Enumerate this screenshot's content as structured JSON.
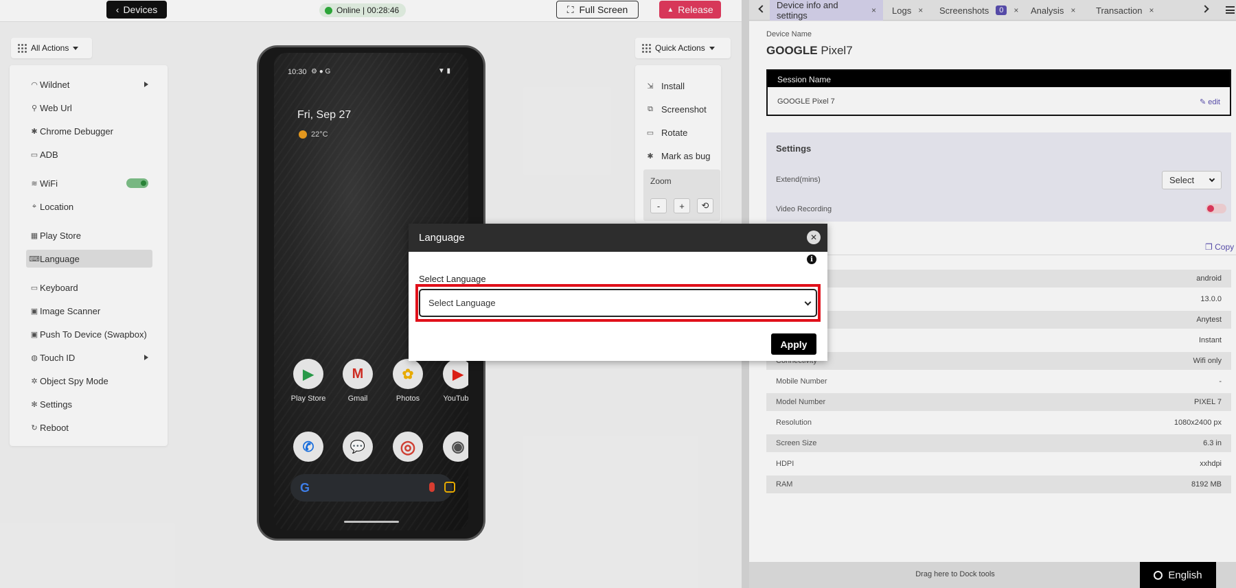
{
  "topbar": {
    "devices_label": "Devices",
    "status_text": "Online | 00:28:46",
    "fullscreen_label": "Full Screen",
    "release_label": "Release"
  },
  "all_actions": {
    "button_label": "All Actions",
    "items": [
      {
        "label": "Wildnet",
        "icon": "wildnet-icon"
      },
      {
        "label": "Web Url",
        "icon": "link-icon"
      },
      {
        "label": "Chrome Debugger",
        "icon": "bug-icon"
      },
      {
        "label": "ADB",
        "icon": "terminal-icon"
      },
      {
        "label": "WiFi",
        "icon": "wifi-icon"
      },
      {
        "label": "Location",
        "icon": "location-pin-icon"
      },
      {
        "label": "Play Store",
        "icon": "apps-icon"
      },
      {
        "label": "Language",
        "icon": "language-icon"
      },
      {
        "label": "Keyboard",
        "icon": "keyboard-icon"
      },
      {
        "label": "Image Scanner",
        "icon": "scanner-icon"
      },
      {
        "label": "Push To Device (Swapbox)",
        "icon": "push-icon"
      },
      {
        "label": "Touch ID",
        "icon": "fingerprint-icon"
      },
      {
        "label": "Object Spy Mode",
        "icon": "spy-icon"
      },
      {
        "label": "Settings",
        "icon": "gear-icon"
      },
      {
        "label": "Reboot",
        "icon": "reboot-icon"
      }
    ]
  },
  "quick_actions": {
    "button_label": "Quick Actions",
    "items": [
      "Install",
      "Screenshot",
      "Rotate",
      "Mark as bug"
    ],
    "zoom_label": "Zoom",
    "zoom_minus": "-",
    "zoom_plus": "+"
  },
  "phone": {
    "time": "10:30",
    "status_glyphs": "⚙ ● G",
    "right_glyphs": "▼ ▮",
    "date": "Fri, Sep 27",
    "temperature": "22°C",
    "apps_row1": [
      "Play Store",
      "Gmail",
      "Photos",
      "YouTube"
    ],
    "apps_row1_glyphs": [
      "▶",
      "M",
      "✿",
      "▶"
    ],
    "apps_row2_icons": [
      "phone-icon",
      "messages-icon",
      "chrome-icon",
      "camera-icon"
    ],
    "apps_row2_glyphs": [
      "✆",
      "💬",
      "◎",
      "◉"
    ],
    "search_logo": "G"
  },
  "modal": {
    "title": "Language",
    "close_glyph": "✕",
    "info_glyph": "i",
    "select_label": "Select Language",
    "select_value": "Select Language",
    "apply_label": "Apply"
  },
  "right_panel": {
    "tabs": [
      {
        "label": "Device info and settings"
      },
      {
        "label": "Logs"
      },
      {
        "label": "Screenshots",
        "badge": "0"
      },
      {
        "label": "Analysis"
      },
      {
        "label": "Transaction"
      }
    ],
    "tab_close_glyph": "×",
    "device_name_label": "Device Name",
    "device_brand": "GOOGLE",
    "device_model": "Pixel7",
    "session_name_header": "Session Name",
    "session_name_value": "GOOGLE Pixel 7",
    "edit_label": "edit",
    "settings_title": "Settings",
    "extend_label": "Extend(mins)",
    "extend_select": "Select",
    "video_recording_label": "Video Recording",
    "copy_label": "Copy",
    "info_rows": [
      {
        "key": "",
        "value": "android"
      },
      {
        "key": "",
        "value": "13.0.0"
      },
      {
        "key": "",
        "value": "Anytest"
      },
      {
        "key": "",
        "value": "Instant"
      },
      {
        "key": "Connectivity",
        "value": "Wifi only"
      },
      {
        "key": "Mobile Number",
        "value": "-"
      },
      {
        "key": "Model Number",
        "value": "PIXEL 7"
      },
      {
        "key": "Resolution",
        "value": "1080x2400 px"
      },
      {
        "key": "Screen Size",
        "value": "6.3 in"
      },
      {
        "key": "HDPI",
        "value": "xxhdpi"
      },
      {
        "key": "RAM",
        "value": "8192 MB"
      }
    ],
    "dock_text": "Drag here to Dock tools",
    "english_label": "English"
  }
}
